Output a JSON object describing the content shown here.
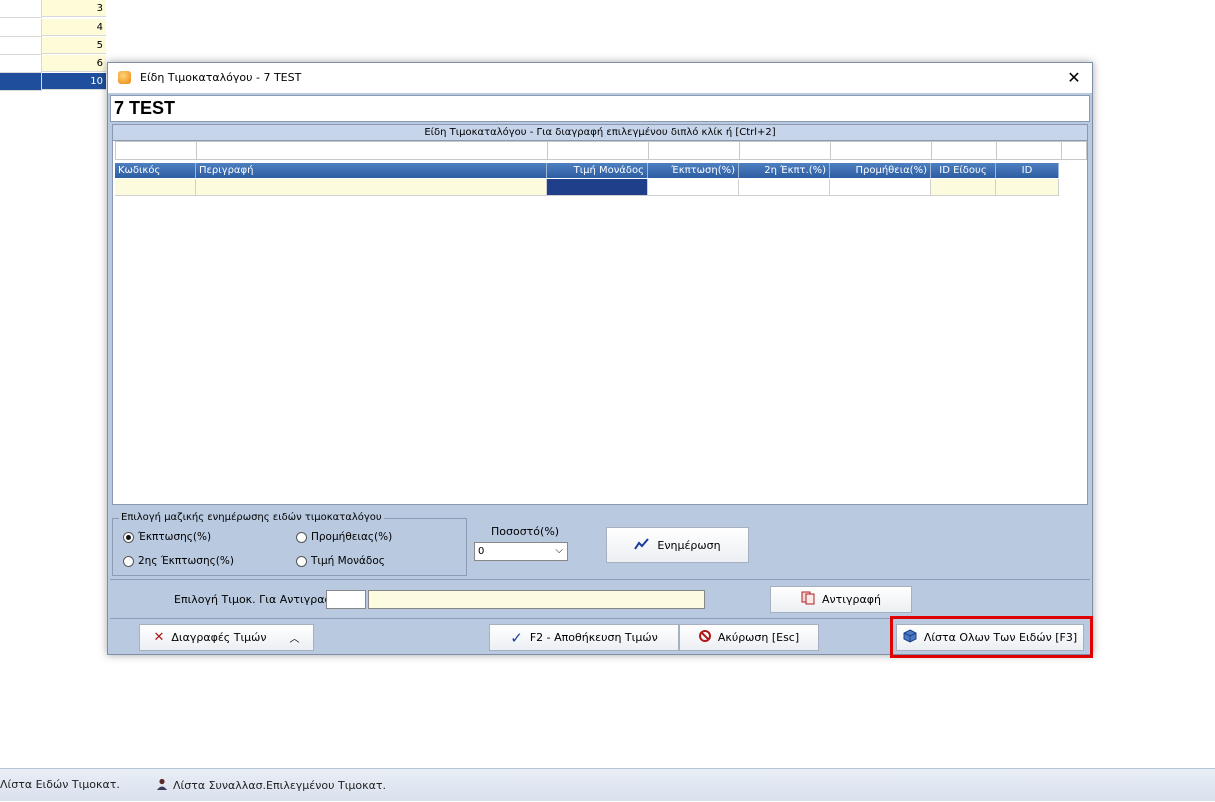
{
  "background": {
    "rows": [
      "3",
      "4",
      "5",
      "6",
      "10"
    ],
    "selected_row_value": "10"
  },
  "dialog": {
    "title": "Είδη Τιμοκαταλόγου - 7  TEST",
    "header": "7  TEST",
    "grid_caption": "Είδη Τιμοκαταλόγου - Για διαγραφή επιλεγμένου διπλό κλίκ ή [Ctrl+2]",
    "columns": [
      "Κωδικός",
      "Περιγραφή",
      "Τιμή Μονάδος",
      "Έκπτωση(%)",
      "2η Έκπτ.(%)",
      "Προμήθεια(%)",
      "ID Είδους",
      "ID"
    ],
    "mass_update": {
      "legend": "Επιλογή μαζικής ενημέρωσης ειδών τιμοκαταλόγου",
      "options": [
        "Έκπτωσης(%)",
        "Προμήθειας(%)",
        "2ης Έκπτωσης(%)",
        "Τιμή Μονάδος"
      ],
      "selected_option": "Έκπτωσης(%)",
      "percent_label": "Ποσοστό(%)",
      "percent_value": "0",
      "update_button": "Ενημέρωση"
    },
    "copy": {
      "label": "Επιλογή Τιμοκ. Για Αντιγραφή:",
      "code_value": "",
      "name_value": "",
      "button": "Αντιγραφή"
    },
    "buttons": {
      "delete": "Διαγραφές Τιμών",
      "save": "F2 - Αποθήκευση Τιμών",
      "cancel": "Ακύρωση [Esc]",
      "all_items": "Λίστα Ολων Των Ειδών [F3]"
    }
  },
  "taskbar": {
    "item1": "Λίστα Ειδών Τιμοκατ.",
    "item2": "Λίστα Συναλλασ.Επιλεγμένου Τιμοκατ."
  },
  "colors": {
    "accent": "#2d5da2",
    "dialog_bg": "#b9c9e0",
    "highlight": "#e00000"
  }
}
